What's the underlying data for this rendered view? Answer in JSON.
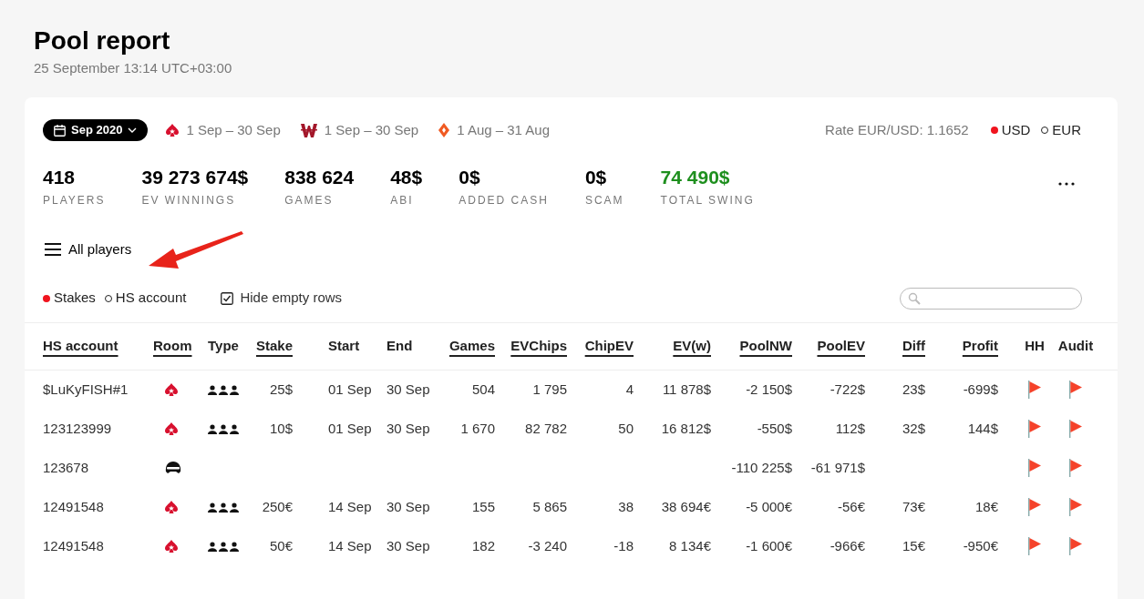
{
  "header": {
    "title": "Pool report",
    "subtitle": "25 September 13:14 UTC+03:00"
  },
  "filters": {
    "period": "Sep 2020",
    "rooms": [
      {
        "kind": "stars",
        "range": "1 Sep – 30 Sep"
      },
      {
        "kind": "winamax",
        "range": "1 Sep – 30 Sep"
      },
      {
        "kind": "party",
        "range": "1 Aug – 31 Aug"
      }
    ],
    "rate": "Rate EUR/USD: 1.1652",
    "currencies": [
      {
        "label": "USD",
        "selected": true
      },
      {
        "label": "EUR",
        "selected": false
      }
    ]
  },
  "stats": [
    {
      "value": "418",
      "label": "PLAYERS",
      "positive": false
    },
    {
      "value": "39 273 674$",
      "label": "EV WINNINGS",
      "positive": false
    },
    {
      "value": "838 624",
      "label": "GAMES",
      "positive": false
    },
    {
      "value": "48$",
      "label": "ABI",
      "positive": false
    },
    {
      "value": "0$",
      "label": "ADDED CASH",
      "positive": false
    },
    {
      "value": "0$",
      "label": "SCAM",
      "positive": false
    },
    {
      "value": "74 490$",
      "label": "TOTAL SWING",
      "positive": true
    }
  ],
  "view": {
    "label": "All players"
  },
  "modes": [
    {
      "label": "Stakes",
      "selected": true
    },
    {
      "label": "HS account",
      "selected": false
    }
  ],
  "hide_empty": {
    "label": "Hide empty rows",
    "checked": true
  },
  "table": {
    "columns": [
      {
        "label": "HS account",
        "sortable": true
      },
      {
        "label": "Room",
        "sortable": true
      },
      {
        "label": "Type",
        "sortable": false
      },
      {
        "label": "Stake",
        "sortable": true
      },
      {
        "label": "Start",
        "sortable": false
      },
      {
        "label": "End",
        "sortable": false
      },
      {
        "label": "Games",
        "sortable": true
      },
      {
        "label": "EVChips",
        "sortable": true
      },
      {
        "label": "ChipEV",
        "sortable": true
      },
      {
        "label": "EV(w)",
        "sortable": true
      },
      {
        "label": "PoolNW",
        "sortable": true
      },
      {
        "label": "PoolEV",
        "sortable": true
      },
      {
        "label": "Diff",
        "sortable": true
      },
      {
        "label": "Profit",
        "sortable": true
      },
      {
        "label": "HH",
        "sortable": false
      },
      {
        "label": "Audit",
        "sortable": false
      }
    ],
    "rows": [
      {
        "account": "$LuKyFISH#1",
        "room": {
          "kind": "stars"
        },
        "type": {
          "kind": "group"
        },
        "stake": "25$",
        "start": "01 Sep",
        "end": "30 Sep",
        "games": "504",
        "evchips": "1 795",
        "chipev": "4",
        "evw": "11 878$",
        "poolnw": "-2 150$",
        "poolev": "-722$",
        "diff": "23$",
        "profit": "-699$"
      },
      {
        "account": "123123999",
        "room": {
          "kind": "stars"
        },
        "type": {
          "kind": "group"
        },
        "stake": "10$",
        "start": "01 Sep",
        "end": "30 Sep",
        "games": "1 670",
        "evchips": "82 782",
        "chipev": "50",
        "evw": "16 812$",
        "poolnw": "-550$",
        "poolev": "112$",
        "diff": "32$",
        "profit": "144$"
      },
      {
        "account": "123678",
        "room": {
          "kind": "masked"
        },
        "poolnw": "-110 225$",
        "poolev": "-61 971$"
      },
      {
        "account": "12491548",
        "room": {
          "kind": "stars"
        },
        "type": {
          "kind": "group"
        },
        "stake": "250€",
        "start": "14 Sep",
        "end": "30 Sep",
        "games": "155",
        "evchips": "5 865",
        "chipev": "38",
        "evw": "38 694€",
        "poolnw": "-5 000€",
        "poolev": "-56€",
        "diff": "73€",
        "profit": "18€"
      },
      {
        "account": "12491548",
        "room": {
          "kind": "stars"
        },
        "type": {
          "kind": "group"
        },
        "stake": "50€",
        "start": "14 Sep",
        "end": "30 Sep",
        "games": "182",
        "evchips": "-3 240",
        "chipev": "-18",
        "evw": "8 134€",
        "poolnw": "-1 600€",
        "poolev": "-966€",
        "diff": "15€",
        "profit": "-950€"
      }
    ]
  }
}
